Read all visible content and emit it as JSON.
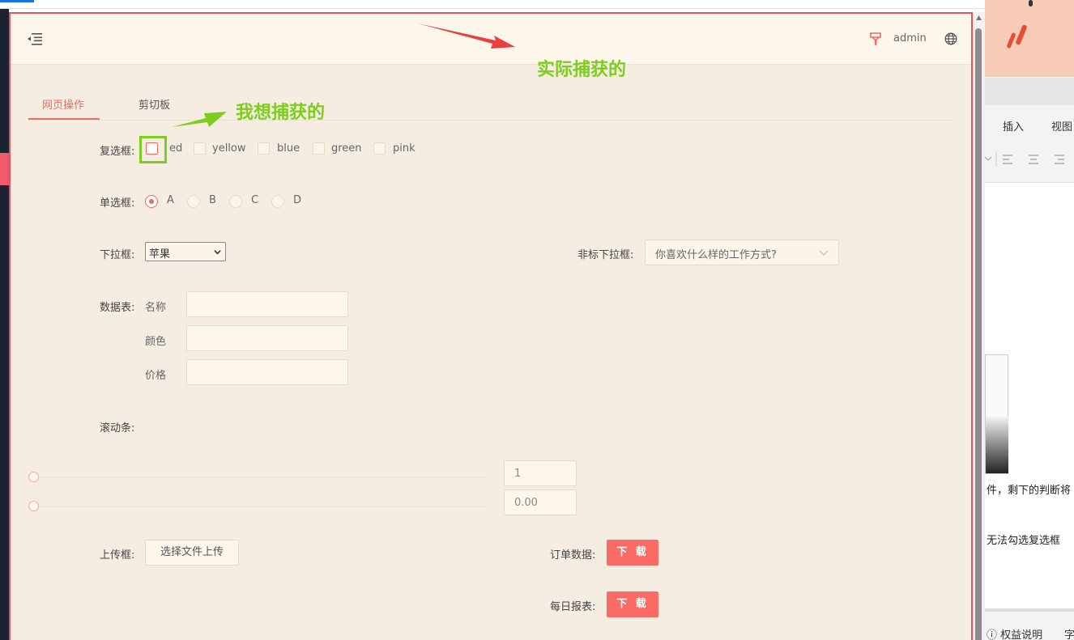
{
  "header": {
    "user": "admin"
  },
  "tabs": [
    {
      "label": "网页操作"
    },
    {
      "label": "剪切板"
    }
  ],
  "checkbox": {
    "label": "复选框:",
    "options": [
      "red",
      "yellow",
      "blue",
      "green",
      "pink"
    ],
    "first_partial": "ed"
  },
  "radio": {
    "label": "单选框:",
    "options": [
      "A",
      "B",
      "C",
      "D"
    ],
    "selected": "A"
  },
  "select": {
    "label": "下拉框:",
    "value": "苹果",
    "options": [
      "苹果"
    ]
  },
  "custom_select": {
    "label": "非标下拉框:",
    "placeholder": "你喜欢什么样的工作方式?"
  },
  "table": {
    "label": "数据表:",
    "fields": [
      "名称",
      "颜色",
      "价格"
    ]
  },
  "slider": {
    "label": "滚动条:",
    "value1": "1",
    "value2": "0.00"
  },
  "upload": {
    "label": "上传框:",
    "button": "选择文件上传"
  },
  "downloads": [
    {
      "label": "订单数据:",
      "button": "下 载"
    },
    {
      "label": "每日报表:",
      "button": "下 载"
    }
  ],
  "annotations": {
    "actual": "实际捕获的",
    "wanted": "我想捕获的"
  },
  "right_pane": {
    "tabs": [
      "插入",
      "视图"
    ],
    "text1": "件，剩下的判断将",
    "text2": "无法勾选复选框",
    "bottom1": "ⓘ 权益说明",
    "bottom2": "字"
  },
  "colors": {
    "accent": "#f06b5f",
    "highlight": "#7dcc1e",
    "frame": "#e8505b",
    "button": "#fa6b66"
  }
}
